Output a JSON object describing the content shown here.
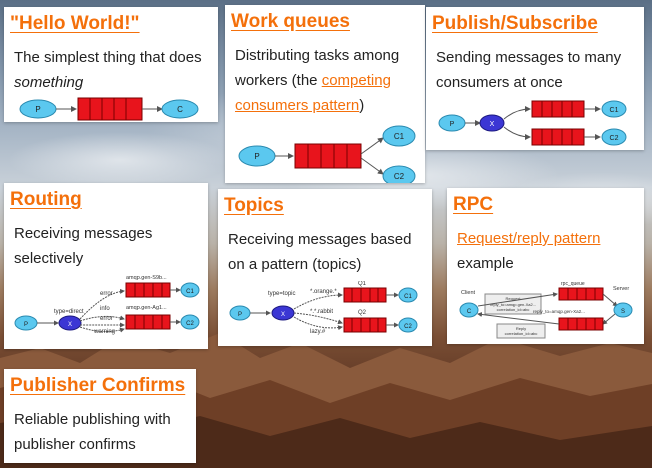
{
  "colors": {
    "accent": "#f4700b",
    "queue": "#e8141c",
    "consumer": "#5bc8ef",
    "exchange": "#3b36d4"
  },
  "cards": {
    "hello": {
      "title": "\"Hello World!\"",
      "desc_line1": "The simplest thing that does",
      "desc_em": "something",
      "nodes": {
        "producer": "P",
        "consumer": "C"
      }
    },
    "work": {
      "title": "Work queues",
      "desc_pre": "Distributing tasks among workers (the ",
      "desc_link": "competing consumers pattern",
      "desc_post": ")",
      "nodes": {
        "producer": "P",
        "consumer1": "C1",
        "consumer2": "C2"
      }
    },
    "pubsub": {
      "title": "Publish/Subscribe",
      "desc": "Sending messages to many consumers at once",
      "nodes": {
        "producer": "P",
        "exchange": "X",
        "consumer1": "C1",
        "consumer2": "C2"
      }
    },
    "routing": {
      "title": "Routing",
      "desc": "Receiving messages selectively",
      "labels": {
        "type": "type=direct",
        "queue1": "amqp.gen-S9b...",
        "queue2": "amqp.gen-Ag1...",
        "key_error": "error",
        "key_info": "info",
        "key_error2": "error",
        "key_warning": "warning"
      },
      "nodes": {
        "producer": "P",
        "exchange": "X",
        "consumer1": "C1",
        "consumer2": "C2"
      }
    },
    "topics": {
      "title": "Topics",
      "desc": "Receiving messages based on a pattern (topics)",
      "labels": {
        "type": "type=topic",
        "q1": "Q1",
        "q2": "Q2",
        "key1": "*.orange.*",
        "key2": "*.*.rabbit",
        "key3": "lazy.#"
      },
      "nodes": {
        "producer": "P",
        "exchange": "X",
        "consumer1": "C1",
        "consumer2": "C2"
      }
    },
    "rpc": {
      "title": "RPC",
      "desc_link": "Request/reply pattern",
      "desc_post": "example",
      "labels": {
        "client": "Client",
        "server": "Server",
        "rpc_queue": "rpc_queue",
        "reply_queue": "reply_to=amqp.gen-Xa2...",
        "request_box_1": "Request",
        "request_box_2": "reply_to=amqp.gen-Xa2...",
        "request_box_3": "correlation_id=abc",
        "reply_box_1": "Reply",
        "reply_box_2": "correlation_id=abc"
      },
      "nodes": {
        "client": "C",
        "server": "S"
      }
    },
    "confirm": {
      "title": "Publisher Confirms",
      "desc": "Reliable publishing with publisher confirms"
    }
  }
}
